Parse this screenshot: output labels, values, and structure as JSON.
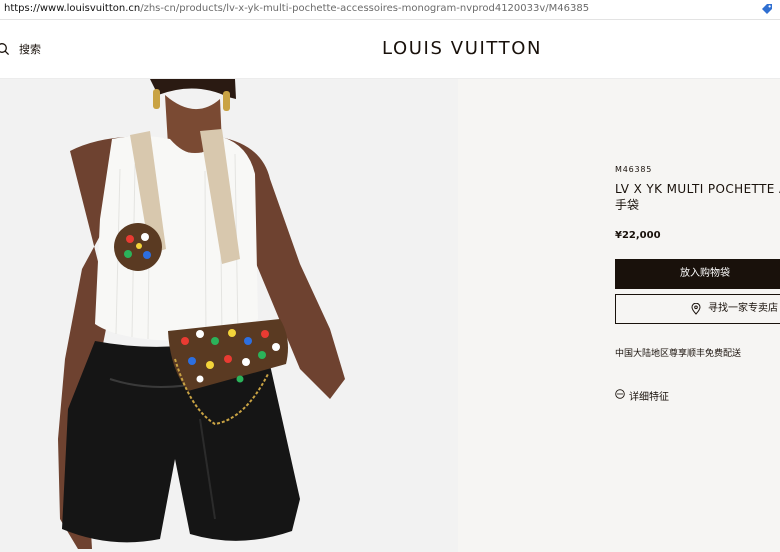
{
  "browser": {
    "url_host": "https://www.louisvuitton.cn",
    "url_path": "/zhs-cn/products/lv-x-yk-multi-pochette-accessoires-monogram-nvprod4120033v/M46385"
  },
  "header": {
    "search_label": "搜索",
    "brand": "LOUIS VUITTON"
  },
  "product": {
    "sku": "M46385",
    "title": "LV X YK MULTI POCHETTE AC",
    "title_cn": "手袋",
    "price": "¥22,000",
    "add_to_cart": "放入购物袋",
    "find_store": "寻找一家专卖店",
    "shipping_note": "中国大陆地区尊享顺丰免费配送",
    "details_label": "详细特征"
  },
  "colors": {
    "accent": "#19110b",
    "panel_bg": "#f6f5f3",
    "image_bg": "#f2f2f2"
  }
}
